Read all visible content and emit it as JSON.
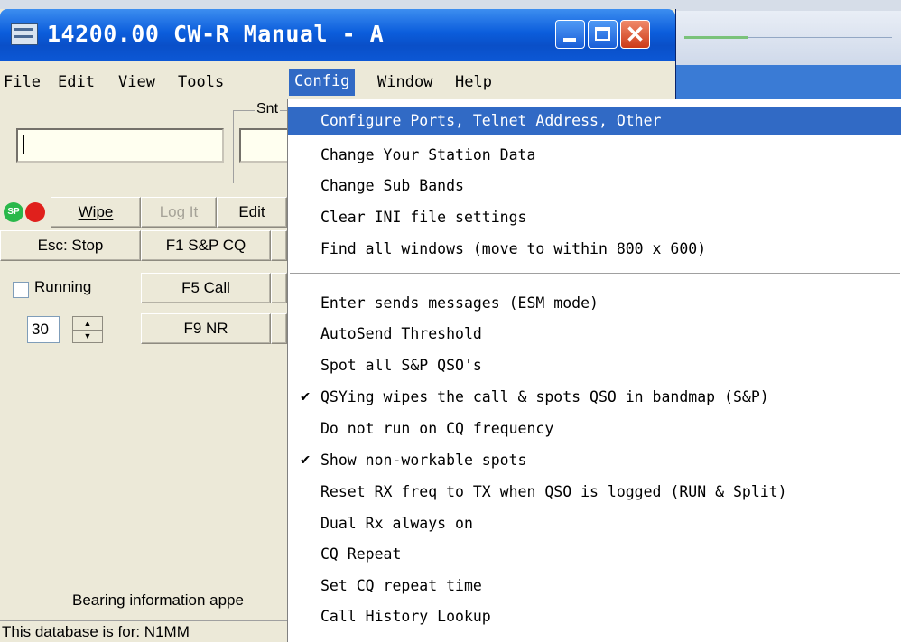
{
  "window": {
    "title": "14200.00 CW-R Manual - A"
  },
  "menubar": [
    "File",
    "Edit",
    "View",
    "Tools",
    "Config",
    "Window",
    "Help"
  ],
  "entry": {
    "snt_label": "Snt",
    "call_value": "",
    "sp_indicator": "SP",
    "buttons_row1": [
      "Wipe",
      "Log It",
      "Edit"
    ],
    "buttons_row2": [
      "Esc: Stop",
      "F1 S&P CQ"
    ],
    "buttons_row3": [
      "F5 Call"
    ],
    "buttons_row4": [
      "F9 NR"
    ],
    "running_label": "Running",
    "spinner_value": "30",
    "bearing_text": "Bearing information appe",
    "status_text": "This database is for: N1MM"
  },
  "config_menu": {
    "items": [
      {
        "label": "Configure Ports, Telnet Address, Other",
        "checked": false,
        "highlighted": true
      },
      {
        "label": "Change Your Station Data",
        "checked": false
      },
      {
        "label": "Change Sub Bands",
        "checked": false
      },
      {
        "label": "Clear INI file settings",
        "checked": false
      },
      {
        "label": "Find all windows (move to within 800 x 600)",
        "checked": false
      },
      {
        "label": "Enter sends messages (ESM mode)",
        "checked": false
      },
      {
        "label": "AutoSend Threshold",
        "checked": false
      },
      {
        "label": "Spot all S&P QSO's",
        "checked": false
      },
      {
        "label": "QSYing wipes the call & spots QSO in bandmap (S&P)",
        "checked": true
      },
      {
        "label": "Do not run on CQ frequency",
        "checked": false
      },
      {
        "label": "Show non-workable spots",
        "checked": true
      },
      {
        "label": "Reset RX freq to TX when QSO is logged (RUN & Split)",
        "checked": false
      },
      {
        "label": "Dual Rx always on",
        "checked": false
      },
      {
        "label": "CQ Repeat",
        "checked": false
      },
      {
        "label": "Set CQ repeat time",
        "checked": false
      },
      {
        "label": "Call History Lookup",
        "checked": false
      }
    ],
    "check_glyph": "✔"
  },
  "colors": {
    "highlight": "#316ac5",
    "titlebar": "#0b5ddc",
    "face": "#ece9d8"
  }
}
